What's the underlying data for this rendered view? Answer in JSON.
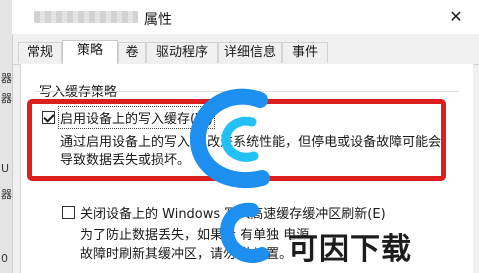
{
  "window": {
    "title": "属性",
    "close_glyph": "✕"
  },
  "left_edge": {
    "glyphs": [
      "器",
      "器",
      "U",
      "器",
      "0"
    ]
  },
  "tabs": [
    {
      "label": "常规",
      "active": false
    },
    {
      "label": "策略",
      "active": true
    },
    {
      "label": "卷",
      "active": false
    },
    {
      "label": "驱动程序",
      "active": false
    },
    {
      "label": "详细信息",
      "active": false
    },
    {
      "label": "事件",
      "active": false
    }
  ],
  "write_cache_policy": {
    "group_label": "写入缓存策略",
    "enable_cache": {
      "label": "启用设备上的写入缓存(W)",
      "checked": true,
      "description_line1": "通过启用设备上的写入缓   改进系统性能，但停电或设备故障可能会",
      "description_line2": "导致数据丢失或损坏。"
    },
    "disable_flush": {
      "label": "关闭设备上的 Windows 写入高速缓存缓冲区刷新(E)",
      "checked": false,
      "description_line1": "为了防止数据丢失，如果设      有单独             电源",
      "description_line2": "故障时刷新其缓冲区，请勿        此设置。"
    }
  },
  "watermark": {
    "text": "可因下载",
    "colors": {
      "blue": "#1c8ff0",
      "cyan": "#22c0f5"
    }
  },
  "colors": {
    "highlight_border": "#dc1e1e",
    "panel_bg": "#ffffff",
    "window_bg": "#f0f0f0"
  }
}
